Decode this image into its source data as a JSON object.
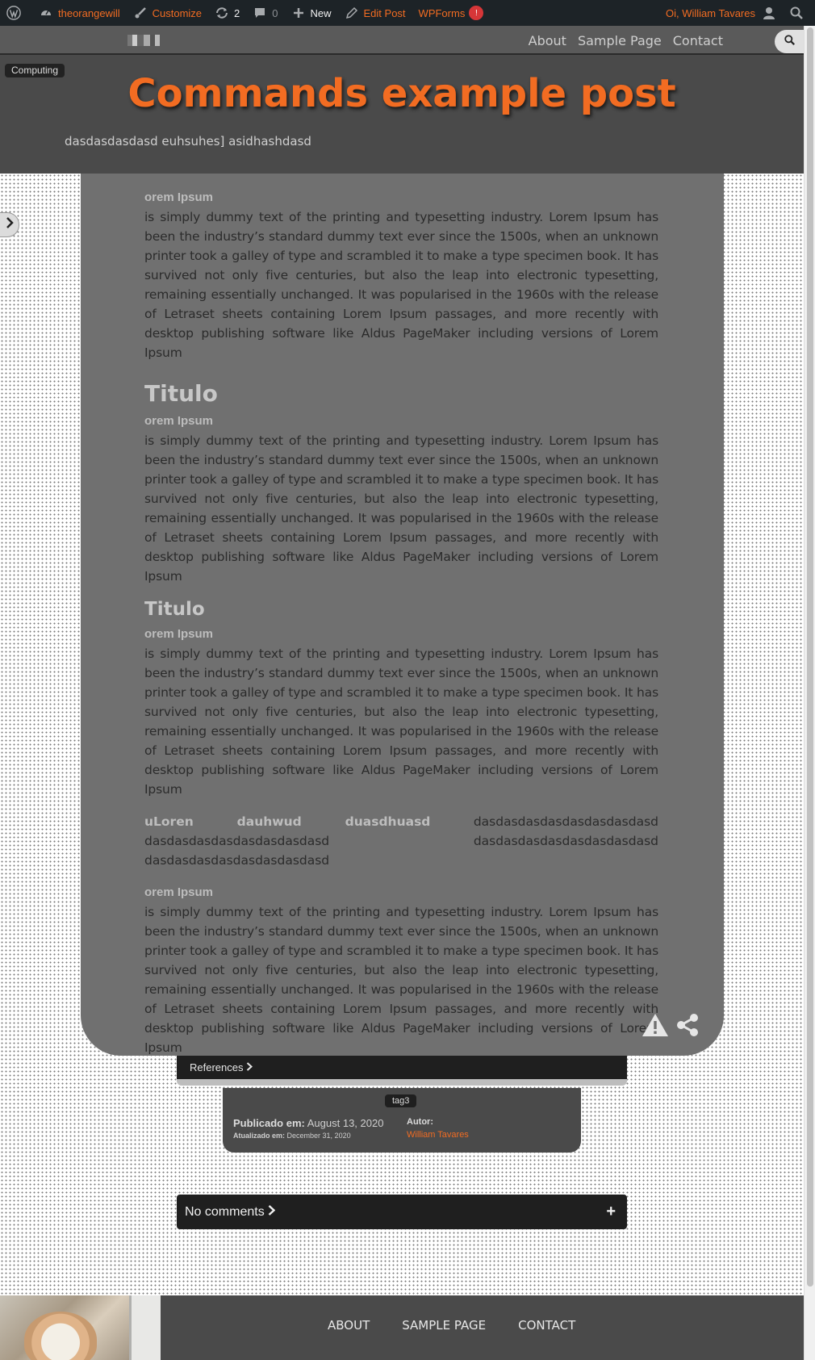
{
  "adminbar": {
    "site_name": "theorangewill",
    "customize": "Customize",
    "updates_count": "2",
    "comments_count": "0",
    "new_label": "New",
    "edit_post": "Edit Post",
    "wpforms": "WPForms",
    "wpforms_badge": "!",
    "greeting": "Oi, William Tavares"
  },
  "nav": {
    "links": [
      "About",
      "Sample Page",
      "Contact"
    ]
  },
  "header": {
    "category": "Computing",
    "title": "Commands example post",
    "subtitle": "dasdasdasdasd euhsuhes] asidhashdasd"
  },
  "content": {
    "lorem_head": "orem Ipsum",
    "lorem_body": " is simply dummy text of the printing and typesetting industry. Lorem Ipsum has been the industry’s standard dummy text ever since the 1500s, when an unknown printer took a galley of type and scrambled it to make a type specimen book. It has survived not only five centuries, but also the leap into electronic typesetting, remaining essentially unchanged. It was popularised in the 1960s with the release of Letraset sheets containing Lorem Ipsum passages, and more recently with desktop publishing software like Aldus PageMaker including versions of Lorem Ipsum",
    "h2": "Titulo",
    "h3": "Titulo",
    "special_bold": "uLoren dauhwud duasdhuasd",
    "special_rest": "dasdasdasdasdasdasdasdasd dasdasdasdasdasdasdasdasd dasdasdasdasdasdasdasdasd dasdasdasdasdasdasdasdasd"
  },
  "references": "References",
  "meta": {
    "tag": "tag3",
    "published_label": "Publicado em:",
    "published_date": "August 13, 2020",
    "updated_label": "Atualizado em:",
    "updated_date": "December 31, 2020",
    "author_label": "Autor:",
    "author_name": "William Tavares"
  },
  "comments": {
    "label": "No comments",
    "plus": "+"
  },
  "footer": {
    "links": [
      "ABOUT",
      "SAMPLE PAGE",
      "CONTACT"
    ]
  },
  "colors": {
    "accent": "#f26c22",
    "adminbar": "#1d2327"
  }
}
